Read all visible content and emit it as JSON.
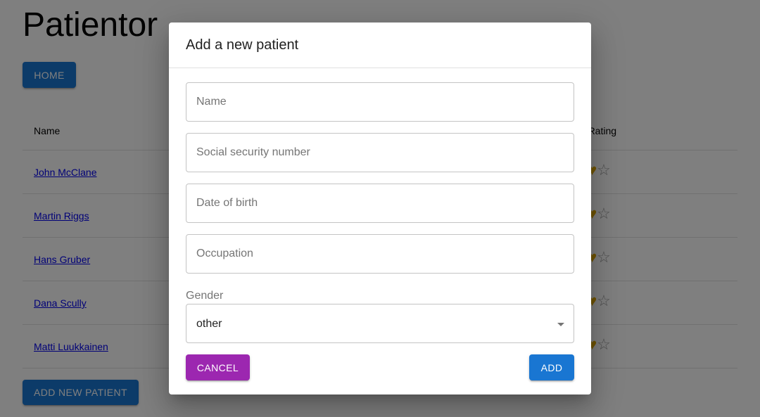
{
  "app": {
    "title": "Patientor",
    "home_label": "HOME",
    "add_new_label": "ADD NEW PATIENT"
  },
  "table": {
    "headers": {
      "name": "Name",
      "rating": "th Rating"
    },
    "rows": [
      {
        "name": "John McClane",
        "hearts": "♥♥",
        "star": "☆"
      },
      {
        "name": "Martin Riggs",
        "hearts": "♥♥",
        "star": "☆"
      },
      {
        "name": "Hans Gruber",
        "hearts": "♥♥",
        "star": "☆"
      },
      {
        "name": "Dana Scully",
        "hearts": "♥♥",
        "star": "☆"
      },
      {
        "name": "Matti Luukkainen",
        "hearts": "♥♥",
        "star": "☆"
      }
    ]
  },
  "dialog": {
    "title": "Add a new patient",
    "fields": {
      "name_placeholder": "Name",
      "ssn_placeholder": "Social security number",
      "dob_placeholder": "Date of birth",
      "occupation_placeholder": "Occupation"
    },
    "gender": {
      "label": "Gender",
      "value": "other"
    },
    "cancel_label": "CANCEL",
    "add_label": "ADD"
  },
  "colors": {
    "primary": "#1976d2",
    "secondary": "#9c27b0",
    "heart": "#e0a800"
  },
  "icons": {
    "rating_filled": "heart-icon",
    "rating_empty": "star-outline-icon",
    "select": "caret-down-icon"
  }
}
